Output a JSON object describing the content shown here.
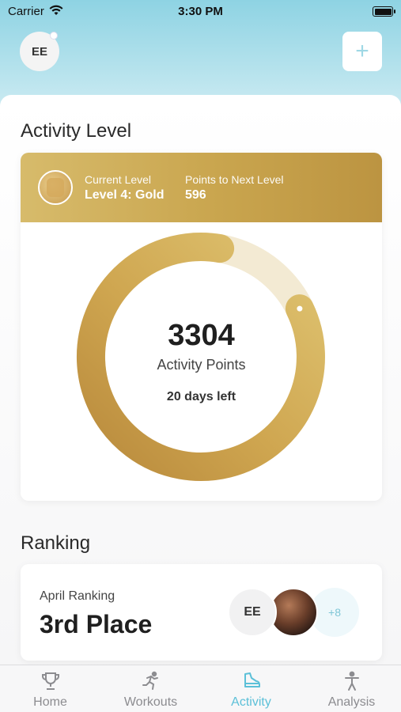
{
  "status_bar": {
    "carrier": "Carrier",
    "time": "3:30 PM"
  },
  "header": {
    "avatar_initials": "EE",
    "add_label": "+"
  },
  "activity": {
    "section_title": "Activity Level",
    "current_level_label": "Current Level",
    "current_level_value": "Level 4: Gold",
    "points_next_label": "Points to Next Level",
    "points_next_value": "596",
    "points": "3304",
    "points_label": "Activity Points",
    "days_left": "20 days left",
    "progress_fraction": 0.85
  },
  "ranking": {
    "section_title": "Ranking",
    "month_label": "April Ranking",
    "place": "3rd Place",
    "avatar_initials": "EE",
    "more_count": "+8"
  },
  "tabs": [
    {
      "label": "Home",
      "icon": "trophy-icon"
    },
    {
      "label": "Workouts",
      "icon": "runner-icon"
    },
    {
      "label": "Activity",
      "icon": "shoe-icon",
      "active": true
    },
    {
      "label": "Analysis",
      "icon": "body-icon"
    }
  ],
  "colors": {
    "accent": "#5cc0d8",
    "gold": "#c9a54e",
    "gold_light": "#f3ead3"
  }
}
